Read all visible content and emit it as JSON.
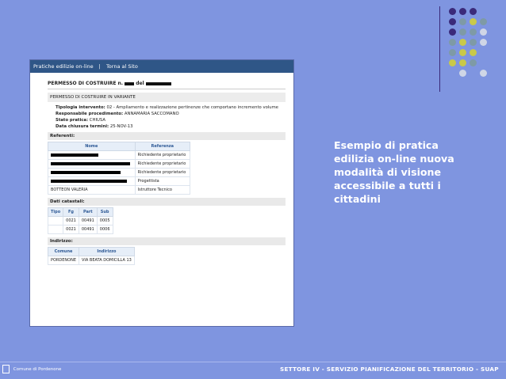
{
  "nav": {
    "link1": "Pratiche edilizie on-line",
    "sep": "|",
    "link2": "Torna al Sito"
  },
  "permit": {
    "title_prefix": "PERMESSO DI COSTRUIRE n.",
    "title_mid": "del",
    "subtitle": "PERMESSO DI COSTRUIRE IN VARIANTE",
    "fields": [
      {
        "label": "Tipologia intervento:",
        "value": "02 - Ampliamento e realizzazione pertinenze che comportano incremento volume"
      },
      {
        "label": "Responsabile procedimento:",
        "value": "ANNAMARIA SACCOMANO"
      },
      {
        "label": "Stato pratica:",
        "value": "CHIUSA"
      },
      {
        "label": "Data chiusura termini:",
        "value": "25-NOV-13"
      }
    ]
  },
  "referenti": {
    "heading": "Referenti:",
    "columns": [
      "Nome",
      "Referenza"
    ],
    "rows": [
      {
        "name": "",
        "ref": "Richiedente proprietario"
      },
      {
        "name": "",
        "ref": "Richiedente proprietario"
      },
      {
        "name": "",
        "ref": "Richiedente proprietario"
      },
      {
        "name": "",
        "ref": "Progettista"
      },
      {
        "name": "BOTTEON VALERIA",
        "ref": "Istruttore Tecnico"
      }
    ]
  },
  "catastali": {
    "heading": "Dati catastali:",
    "columns": [
      "Tipo",
      "Fg",
      "Part",
      "Sub"
    ],
    "rows": [
      [
        "",
        "0021",
        "00491",
        "0005"
      ],
      [
        "",
        "0021",
        "00491",
        "0006"
      ]
    ]
  },
  "indirizzo": {
    "heading": "Indirizzo:",
    "columns": [
      "Comune",
      "Indirizzo"
    ],
    "rows": [
      [
        "PORDENONE",
        "VIA BEATA DOMICILLA 13"
      ]
    ]
  },
  "caption": "Esempio di pratica edilizia on-line nuova modalità di visione accessibile a tutti i cittadini",
  "footer": {
    "left": "Comune di Pordenone",
    "right": "SETTORE IV - SERVIZIO PIANIFICAZIONE DEL TERRITORIO - SUAP"
  },
  "colors": {
    "background": "#7f95e0",
    "dot_purple": "#3b2a7a",
    "dot_gray": "#7e9aa6",
    "dot_yellow": "#c9c94a",
    "dot_light": "#cfd6e6"
  }
}
